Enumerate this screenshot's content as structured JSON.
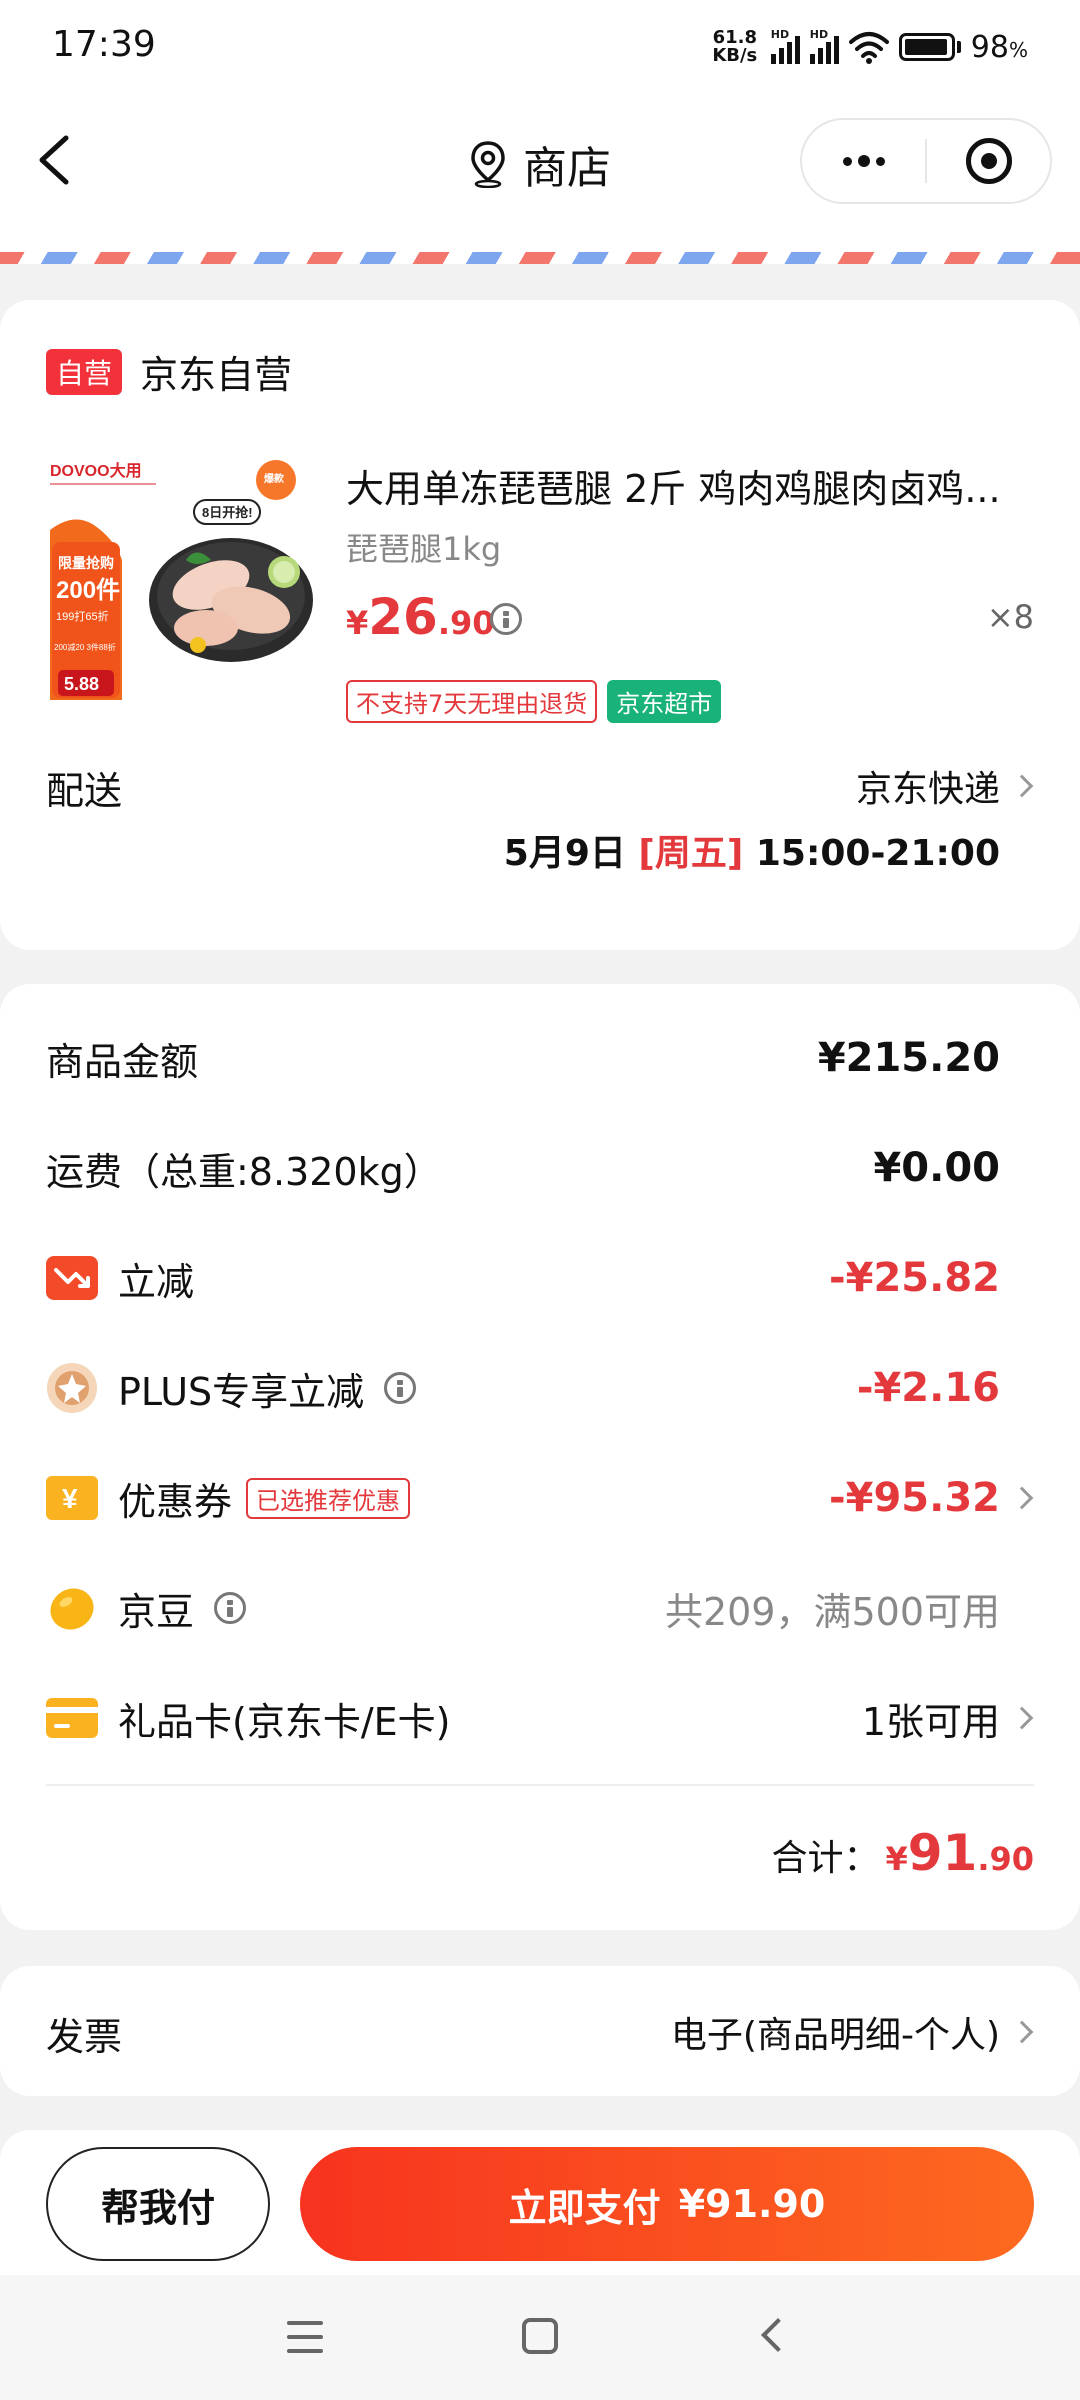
{
  "status_bar": {
    "time": "17:39",
    "net_speed_value": "61.8",
    "net_speed_unit": "KB/s",
    "signal_badge": "HD",
    "battery_level": "98",
    "battery_unit": "%"
  },
  "nav": {
    "title": "商店",
    "back_icon": "chevron-left-icon",
    "location_icon": "location-pin-icon",
    "more_icon": "more-dots-icon",
    "close_icon": "target-icon"
  },
  "store": {
    "badge": "自营",
    "name": "京东自营",
    "product": {
      "image_brand": "DOVOO大用",
      "image_promo_line1": "限量抢购",
      "image_promo_line2": "200件",
      "image_promo_line3": "199打65折",
      "image_promo_line4": "200减20 3件88折",
      "image_price": "5.88",
      "image_hot_badge": "爆款\n抢购",
      "image_tag": "8日开抢!",
      "title": "大用单冻琵琶腿 2斤 鸡肉鸡腿肉卤鸡...",
      "spec": "琵琶腿1kg",
      "price_symbol": "¥",
      "price_int": "26",
      "price_dec": ".90",
      "quantity": "×8",
      "tags": [
        "不支持7天无理由退货",
        "京东超市"
      ]
    },
    "shipping": {
      "label": "配送",
      "method": "京东快递",
      "date": "5月9日 ",
      "weekday": "[周五]",
      "time_slot": " 15:00-21:00"
    }
  },
  "amounts": {
    "rows": [
      {
        "label": "商品金额",
        "value": "¥215.20"
      },
      {
        "label": "运费（总重:8.320kg）",
        "value": "¥0.00"
      },
      {
        "label": "立减",
        "value": "-¥25.82",
        "icon": "discount-down-icon"
      },
      {
        "label": "PLUS专享立减",
        "value": "-¥2.16",
        "icon": "plus-member-icon"
      },
      {
        "label": "优惠券",
        "value": "-¥95.32",
        "icon": "coupon-icon",
        "tag": "已选推荐优惠"
      },
      {
        "label": "京豆",
        "value": "共209，满500可用",
        "icon": "jingdou-bean-icon"
      },
      {
        "label": "礼品卡(京东卡/E卡)",
        "value": "1张可用",
        "icon": "gift-card-icon"
      }
    ],
    "total_label": "合计：",
    "total_symbol": "¥",
    "total_int": "91",
    "total_dec": ".90"
  },
  "invoice": {
    "label": "发票",
    "value": "电子(商品明细-个人)"
  },
  "bottom": {
    "help_pay": "帮我付",
    "pay_label": "立即支付",
    "pay_amount": "¥91.90"
  },
  "colors": {
    "accent_red": "#e4393c",
    "pay_gradient_start": "#f7331f",
    "pay_gradient_end": "#fd6a1f",
    "green_tag": "#19b37a"
  }
}
